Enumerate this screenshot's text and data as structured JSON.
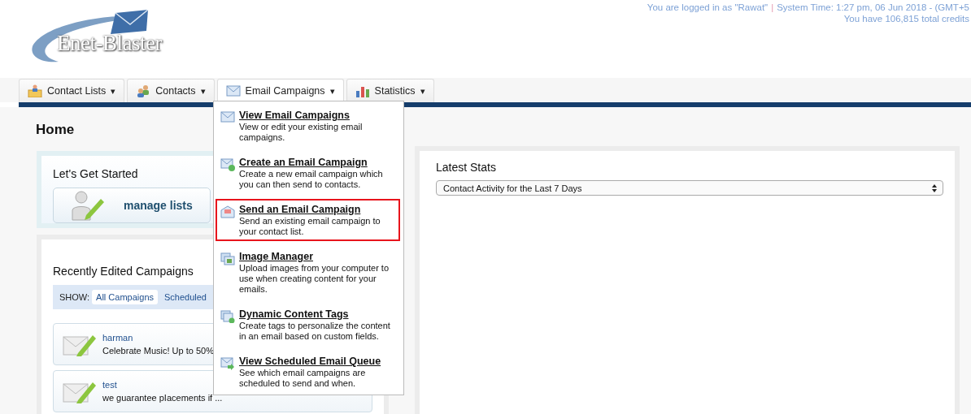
{
  "header": {
    "logo_text": "Enet-Blaster",
    "user_text": "You are logged in as \"Rawat\"",
    "separator": "|",
    "time_text": "System Time: 1:27 pm, 06 Jun 2018 - (GMT+5",
    "credits_text": "You have 106,815 total credits"
  },
  "nav_tabs": [
    {
      "label": "Contact Lists",
      "kind": "lists",
      "caret": "▾",
      "open": false
    },
    {
      "label": "Contacts",
      "kind": "contacts",
      "caret": "▾",
      "open": false
    },
    {
      "label": "Email Campaigns",
      "kind": "email",
      "caret": "▾",
      "open": true
    },
    {
      "label": "Statistics",
      "kind": "stats",
      "caret": "▾",
      "open": false
    }
  ],
  "page_title": "Home",
  "get_started": {
    "title": "Let's Get Started",
    "button": "manage lists"
  },
  "recent": {
    "title": "Recently Edited Campaigns",
    "show_label": "SHOW:",
    "filters": [
      {
        "label": "All Campaigns",
        "selected": true
      },
      {
        "label": "Scheduled",
        "selected": false
      }
    ],
    "campaigns": [
      {
        "name": "harman",
        "subject": "Celebrate Music! Up to 50%"
      },
      {
        "name": "test",
        "subject": "we guarantee pIacements if ..."
      }
    ]
  },
  "latest_stats": {
    "title": "Latest Stats",
    "select_value": "Contact Activity for the Last 7 Days"
  },
  "dropdown": [
    {
      "kind": "view",
      "title": "View Email Campaigns",
      "description": "View or edit your existing email campaigns.",
      "highlighted": false
    },
    {
      "kind": "create",
      "title": "Create an Email Campaign",
      "description": "Create a new email campaign which you can then send to contacts.",
      "highlighted": false
    },
    {
      "kind": "send",
      "title": "Send an Email Campaign",
      "description": "Send an existing email campaign to your contact list.",
      "highlighted": true
    },
    {
      "kind": "images",
      "title": "Image Manager",
      "description": "Upload images from your computer to use when creating content for your emails.",
      "highlighted": false
    },
    {
      "kind": "tags",
      "title": "Dynamic Content Tags",
      "description": "Create tags to personalize the content in an email based on custom fields.",
      "highlighted": false
    },
    {
      "kind": "queue",
      "title": "View Scheduled Email Queue",
      "description": "See which email campaigns are scheduled to send and when.",
      "highlighted": false
    }
  ]
}
